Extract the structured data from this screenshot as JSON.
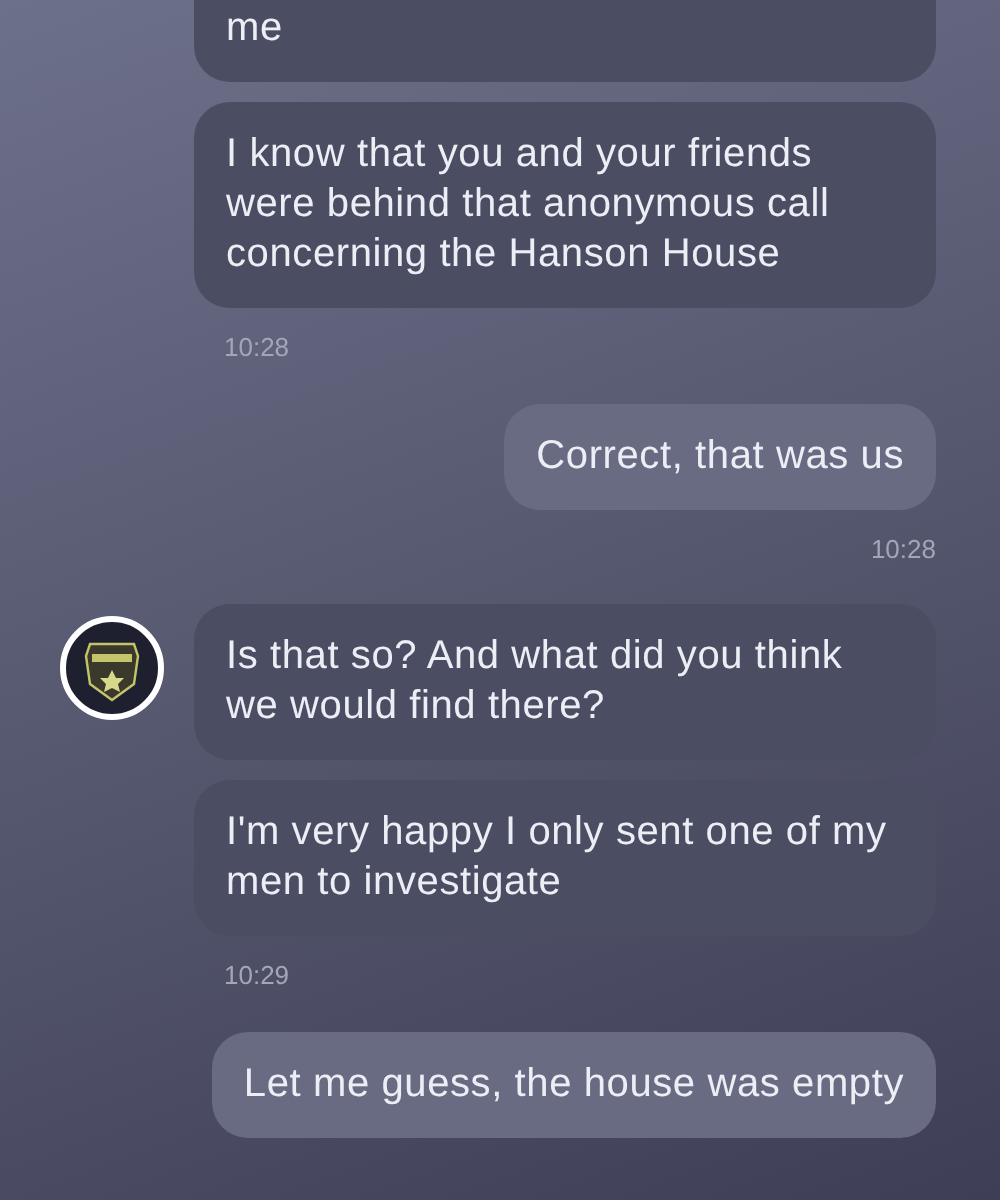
{
  "messages": [
    {
      "kind": "incoming",
      "avatar": false,
      "text": "me"
    },
    {
      "kind": "incoming",
      "avatar": false,
      "text": "I know that you and your friends were behind that anonymous call concerning the Hanson House",
      "time": "10:28"
    },
    {
      "kind": "outgoing",
      "text": "Correct, that was us",
      "time": "10:28"
    },
    {
      "kind": "incoming",
      "avatar": true,
      "text": "Is that so? And what did you think we would find there?"
    },
    {
      "kind": "incoming",
      "avatar": false,
      "text": "I'm very happy I only sent one of my men to investigate",
      "time": "10:29"
    },
    {
      "kind": "outgoing",
      "text": "Let me guess, the house was empty"
    }
  ]
}
